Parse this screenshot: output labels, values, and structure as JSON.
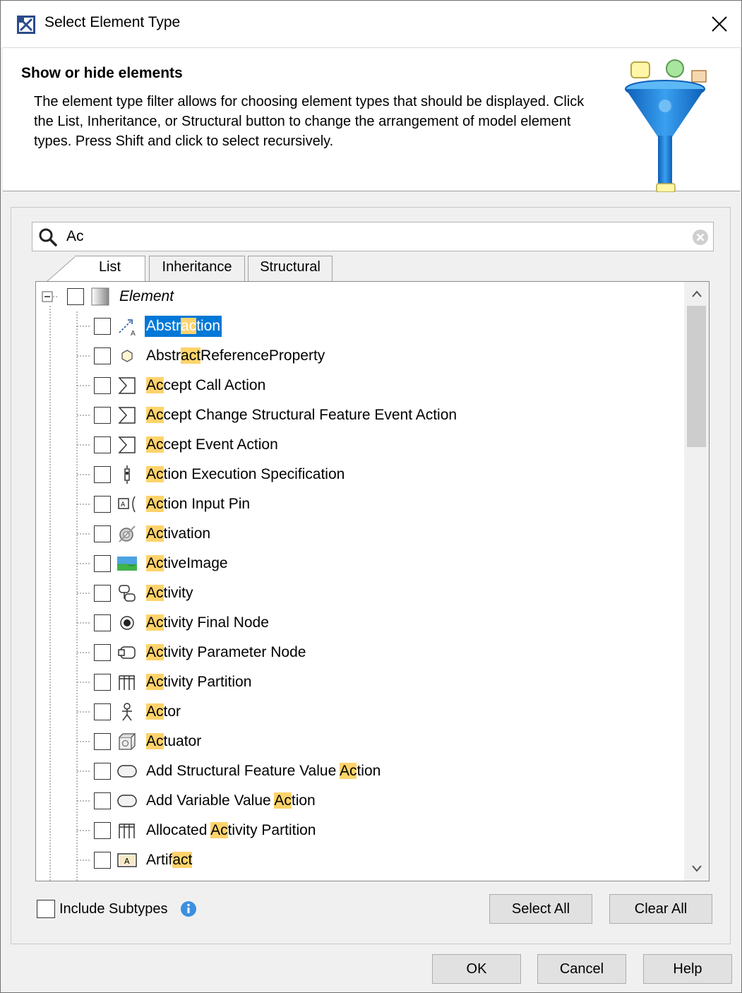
{
  "window": {
    "title": "Select Element Type"
  },
  "header": {
    "title": "Show or hide elements",
    "description": "The element type filter allows for choosing element types that should be displayed. Click the List, Inheritance, or Structural button to change the arrangement of model element types. Press Shift and click to select recursively."
  },
  "search": {
    "value": "Ac"
  },
  "tabs": [
    {
      "label": "List",
      "active": true
    },
    {
      "label": "Inheritance",
      "active": false
    },
    {
      "label": "Structural",
      "active": false
    }
  ],
  "tree": {
    "root": {
      "label": "Element"
    },
    "items": [
      {
        "pre": "Abstr",
        "hl": "ac",
        "post": "tion",
        "icon": "abstraction-icon",
        "selected": true
      },
      {
        "pre": "Abstr",
        "hl": "act",
        "post": "ReferenceProperty",
        "icon": "property-icon"
      },
      {
        "pre": "",
        "hl": "Ac",
        "post": "cept Call Action",
        "icon": "accept-event-icon"
      },
      {
        "pre": "",
        "hl": "Ac",
        "post": "cept Change Structural Feature Event Action",
        "icon": "accept-event-icon"
      },
      {
        "pre": "",
        "hl": "Ac",
        "post": "cept Event Action",
        "icon": "accept-event-icon"
      },
      {
        "pre": "",
        "hl": "Ac",
        "post": "tion Execution Specification",
        "icon": "execution-spec-icon"
      },
      {
        "pre": "",
        "hl": "Ac",
        "post": "tion Input Pin",
        "icon": "input-pin-icon"
      },
      {
        "pre": "",
        "hl": "Ac",
        "post": "tivation",
        "icon": "activation-icon"
      },
      {
        "pre": "",
        "hl": "Ac",
        "post": "tiveImage",
        "icon": "image-icon"
      },
      {
        "pre": "",
        "hl": "Ac",
        "post": "tivity",
        "icon": "activity-icon"
      },
      {
        "pre": "",
        "hl": "Ac",
        "post": "tivity Final Node",
        "icon": "final-node-icon"
      },
      {
        "pre": "",
        "hl": "Ac",
        "post": "tivity Parameter Node",
        "icon": "parameter-node-icon"
      },
      {
        "pre": "",
        "hl": "Ac",
        "post": "tivity Partition",
        "icon": "partition-icon"
      },
      {
        "pre": "",
        "hl": "Ac",
        "post": "tor",
        "icon": "actor-icon"
      },
      {
        "pre": "",
        "hl": "Ac",
        "post": "tuator",
        "icon": "actuator-icon"
      },
      {
        "pre": "Add Structural Feature Value ",
        "hl": "Ac",
        "post": "tion",
        "icon": "action-icon"
      },
      {
        "pre": "Add Variable Value ",
        "hl": "Ac",
        "post": "tion",
        "icon": "action-icon"
      },
      {
        "pre": "Allocated ",
        "hl": "Ac",
        "post": "tivity Partition",
        "icon": "partition-icon"
      },
      {
        "pre": "Artif",
        "hl": "act",
        "post": "",
        "icon": "artifact-icon"
      }
    ]
  },
  "footer": {
    "include_subtypes": "Include Subtypes",
    "select_all": "Select All",
    "clear_all": "Clear All",
    "ok": "OK",
    "cancel": "Cancel",
    "help": "Help"
  },
  "colors": {
    "selection": "#0078d7",
    "highlight": "#ffd36b",
    "funnel": "#1e88e5"
  }
}
